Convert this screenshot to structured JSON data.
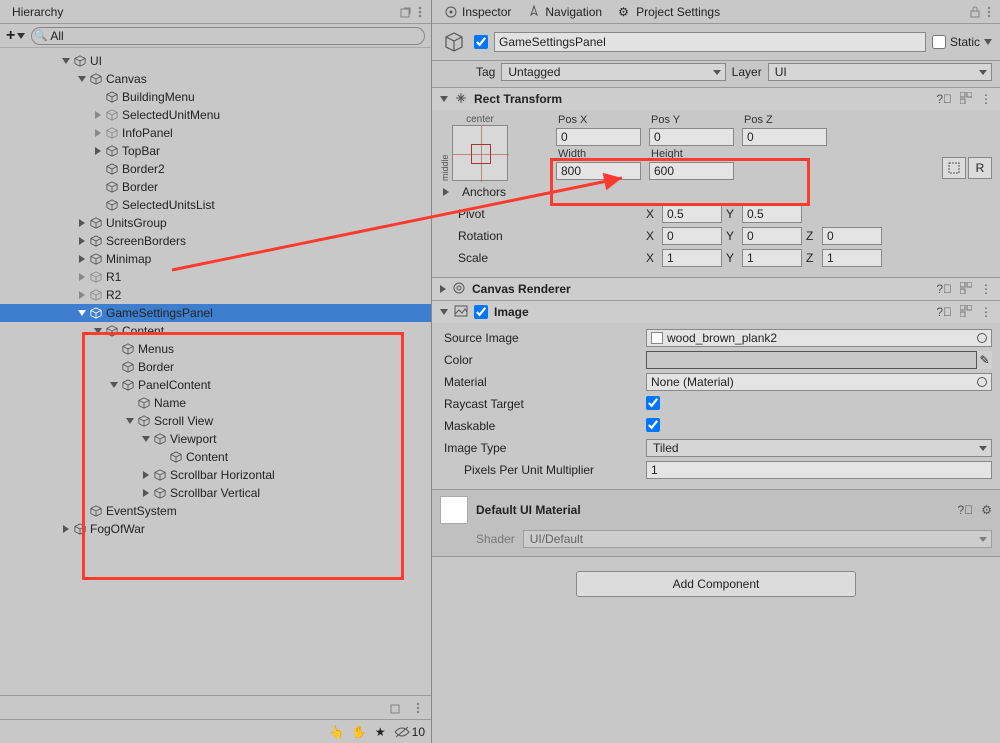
{
  "hierarchy": {
    "title": "Hierarchy",
    "search_value": "All",
    "items": [
      {
        "label": "UI",
        "depth": 2,
        "toggle": "down"
      },
      {
        "label": "Canvas",
        "depth": 3,
        "toggle": "down"
      },
      {
        "label": "BuildingMenu",
        "depth": 4,
        "toggle": ""
      },
      {
        "label": "SelectedUnitMenu",
        "depth": 4,
        "toggle": "right",
        "disabled": true
      },
      {
        "label": "InfoPanel",
        "depth": 4,
        "toggle": "right",
        "disabled": true
      },
      {
        "label": "TopBar",
        "depth": 4,
        "toggle": "right"
      },
      {
        "label": "Border2",
        "depth": 4,
        "toggle": ""
      },
      {
        "label": "Border",
        "depth": 4,
        "toggle": ""
      },
      {
        "label": "SelectedUnitsList",
        "depth": 4,
        "toggle": ""
      },
      {
        "label": "UnitsGroup",
        "depth": 3,
        "toggle": "right"
      },
      {
        "label": "ScreenBorders",
        "depth": 3,
        "toggle": "right"
      },
      {
        "label": "Minimap",
        "depth": 3,
        "toggle": "right"
      },
      {
        "label": "R1",
        "depth": 3,
        "toggle": "right",
        "disabled": true
      },
      {
        "label": "R2",
        "depth": 3,
        "toggle": "right",
        "disabled": true
      },
      {
        "label": "GameSettingsPanel",
        "depth": 3,
        "toggle": "down",
        "selected": true
      },
      {
        "label": "Content",
        "depth": 4,
        "toggle": "down"
      },
      {
        "label": "Menus",
        "depth": 5,
        "toggle": ""
      },
      {
        "label": "Border",
        "depth": 5,
        "toggle": ""
      },
      {
        "label": "PanelContent",
        "depth": 5,
        "toggle": "down"
      },
      {
        "label": "Name",
        "depth": 6,
        "toggle": ""
      },
      {
        "label": "Scroll View",
        "depth": 6,
        "toggle": "down"
      },
      {
        "label": "Viewport",
        "depth": 7,
        "toggle": "down"
      },
      {
        "label": "Content",
        "depth": 8,
        "toggle": ""
      },
      {
        "label": "Scrollbar Horizontal",
        "depth": 7,
        "toggle": "right"
      },
      {
        "label": "Scrollbar Vertical",
        "depth": 7,
        "toggle": "right"
      },
      {
        "label": "EventSystem",
        "depth": 3,
        "toggle": ""
      },
      {
        "label": "FogOfWar",
        "depth": 2,
        "toggle": "right"
      }
    ],
    "layer_count": "10"
  },
  "inspector": {
    "tabs": {
      "inspector": "Inspector",
      "navigation": "Navigation",
      "project_settings": "Project Settings"
    },
    "object_name": "GameSettingsPanel",
    "static_label": "Static",
    "tag_label": "Tag",
    "tag_value": "Untagged",
    "layer_label": "Layer",
    "layer_value": "UI",
    "rect_transform": {
      "title": "Rect Transform",
      "anchor_top": "center",
      "anchor_side": "middle",
      "posx_lbl": "Pos X",
      "posy_lbl": "Pos Y",
      "posz_lbl": "Pos Z",
      "posx": "0",
      "posy": "0",
      "posz": "0",
      "width_lbl": "Width",
      "height_lbl": "Height",
      "width": "800",
      "height": "600",
      "anchors_lbl": "Anchors",
      "pivot_lbl": "Pivot",
      "pivot_x": "0.5",
      "pivot_y": "0.5",
      "rotation_lbl": "Rotation",
      "rot_x": "0",
      "rot_y": "0",
      "rot_z": "0",
      "scale_lbl": "Scale",
      "scale_x": "1",
      "scale_y": "1",
      "scale_z": "1",
      "btn_r": "R"
    },
    "canvas_renderer": {
      "title": "Canvas Renderer"
    },
    "image": {
      "title": "Image",
      "source_lbl": "Source Image",
      "source_val": "wood_brown_plank2",
      "color_lbl": "Color",
      "color_hex": "#8a8248",
      "material_lbl": "Material",
      "material_val": "None (Material)",
      "raycast_lbl": "Raycast Target",
      "maskable_lbl": "Maskable",
      "imgtype_lbl": "Image Type",
      "imgtype_val": "Tiled",
      "ppu_lbl": "Pixels Per Unit Multiplier",
      "ppu_val": "1"
    },
    "material": {
      "title": "Default UI Material",
      "shader_lbl": "Shader",
      "shader_val": "UI/Default"
    },
    "add_component": "Add Component"
  },
  "labels": {
    "x": "X",
    "y": "Y",
    "z": "Z"
  }
}
